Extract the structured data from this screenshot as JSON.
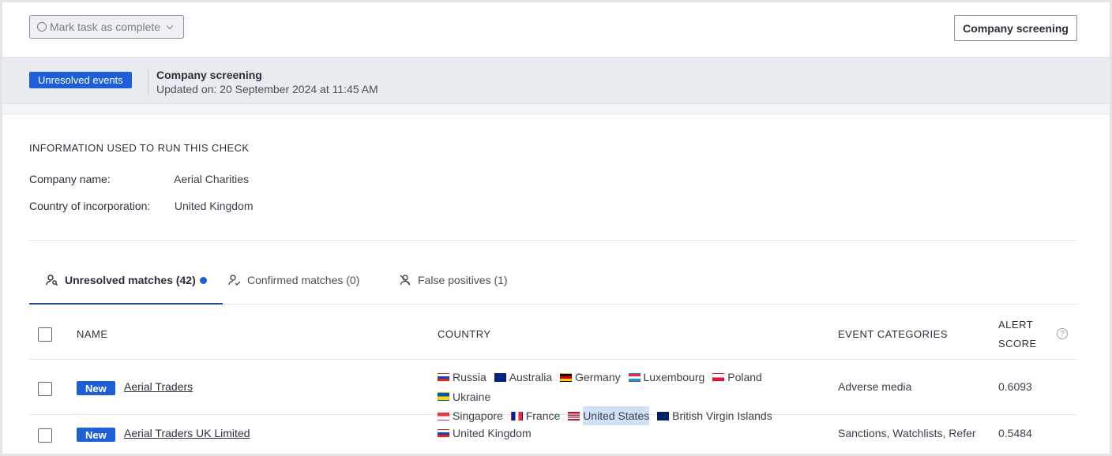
{
  "topbar": {
    "mark_complete_label": "Mark task as complete",
    "company_screening_button": "Company screening"
  },
  "banner": {
    "badge": "Unresolved events",
    "title": "Company screening",
    "updated": "Updated on: 20 September 2024 at 11:45 AM"
  },
  "info": {
    "heading": "INFORMATION USED TO RUN THIS CHECK",
    "company_name_label": "Company name:",
    "company_name_value": "Aerial Charities",
    "country_label": "Country of incorporation:",
    "country_value": "United Kingdom"
  },
  "tabs": [
    {
      "label": "Unresolved matches (42)",
      "active": true,
      "icon": "person-search-icon"
    },
    {
      "label": "Confirmed matches (0)",
      "active": false,
      "icon": "person-check-icon"
    },
    {
      "label": "False positives (1)",
      "active": false,
      "icon": "person-off-icon"
    }
  ],
  "table": {
    "headers": {
      "name": "NAME",
      "country": "COUNTRY",
      "event_categories": "EVENT CATEGORIES",
      "alert_score_line1": "ALERT",
      "alert_score_line2": "SCORE"
    },
    "rows": [
      {
        "badge": "New",
        "name": "Aerial Traders",
        "countries": [
          "Russia",
          "Australia",
          "Germany",
          "Luxembourg",
          "Poland",
          "Ukraine",
          "Singapore",
          "France",
          "United States",
          "British Virgin Islands"
        ],
        "event_categories": "Adverse media",
        "score": "0.6093"
      },
      {
        "badge": "New",
        "name": "Aerial Traders UK Limited",
        "countries": [
          "United Kingdom"
        ],
        "event_categories": "Sanctions, Watchlists, Refer",
        "score": "0.5484"
      }
    ]
  }
}
